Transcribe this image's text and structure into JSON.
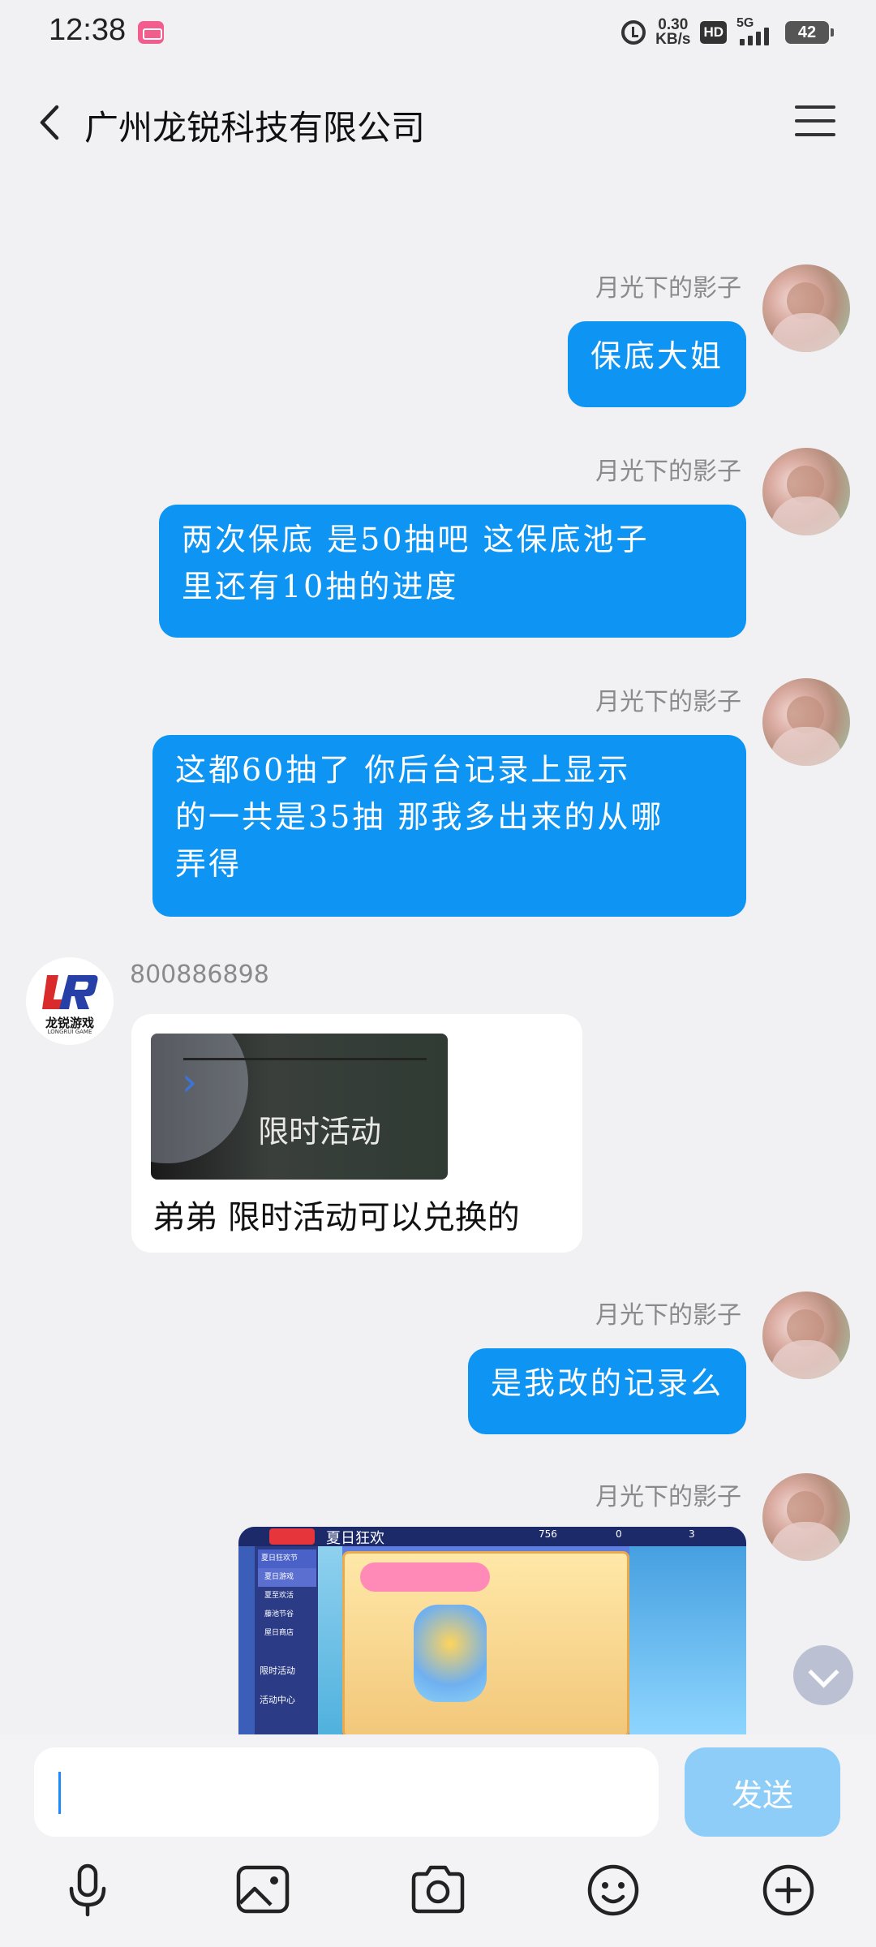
{
  "status_bar": {
    "time": "12:38",
    "net_speed_value": "0.30",
    "net_speed_unit": "KB/s",
    "hd": "HD",
    "network": "5G",
    "battery": "42"
  },
  "header": {
    "title": "广州龙锐科技有限公司"
  },
  "messages": [
    {
      "sender": "月光下的影子",
      "text_lines": [
        "保底大姐"
      ]
    },
    {
      "sender": "月光下的影子",
      "text_lines": [
        "两次保底  是50抽吧  这保底池子",
        "里还有10抽的进度"
      ]
    },
    {
      "sender": "月光下的影子",
      "text_lines": [
        "这都60抽了    你后台记录上显示",
        "的一共是35抽  那我多出来的从哪",
        "弄得"
      ]
    },
    {
      "sender": "800886898",
      "avatar_text": "龙锐游戏",
      "avatar_sub": "LONGRUI GAME",
      "image_label": "限时活动",
      "text": "弟弟 限时活动可以兑换的"
    },
    {
      "sender": "月光下的影子",
      "text_lines": [
        "是我改的记录么"
      ]
    },
    {
      "sender": "月光下的影子",
      "game_title": "夏日狂欢",
      "game_menu": [
        "夏日狂欢节",
        "夏日游戏",
        "夏至欢活",
        "藤池节谷",
        "屋日商店"
      ],
      "game_side": [
        "限时活动",
        "活动中心"
      ],
      "game_stats": [
        "756",
        "0",
        "3"
      ]
    }
  ],
  "input": {
    "placeholder": "",
    "send_label": "发送"
  },
  "toolbar": [
    "microphone-icon",
    "image-icon",
    "camera-icon",
    "emoji-icon",
    "plus-circle-icon"
  ],
  "colors": {
    "bubble_blue": "#0e94f2",
    "background": "#f1f1f3",
    "send_button": "#8fcdf9"
  }
}
